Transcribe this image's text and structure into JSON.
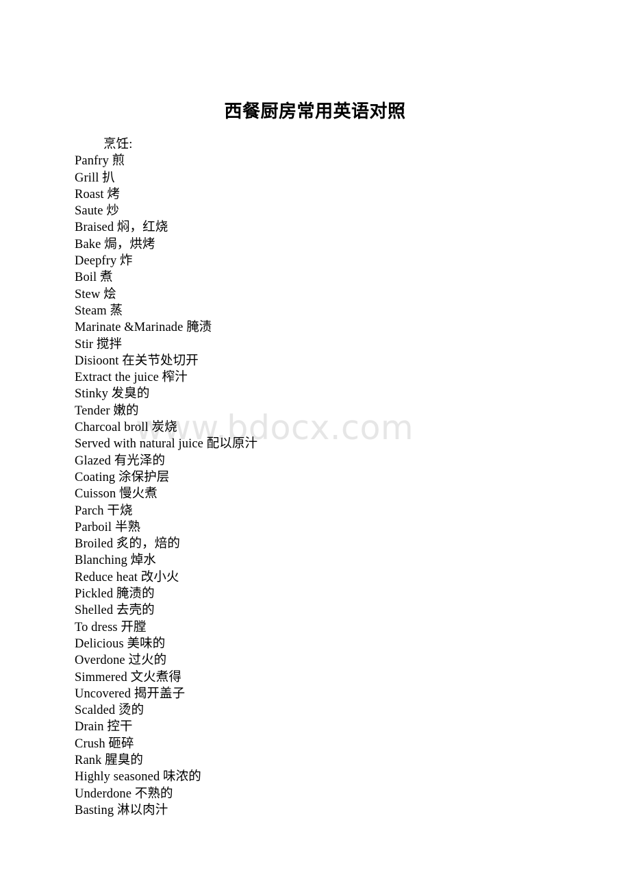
{
  "document": {
    "title": "西餐厨房常用英语对照",
    "watermark": "www.bdocx.com",
    "section_heading": "烹饪:",
    "entries": [
      "Panfry 煎",
      "Grill 扒",
      "Roast 烤",
      "Saute 炒",
      "Braised 焖，红烧",
      "Bake 焗，烘烤",
      "Deepfry 炸",
      "Boil 煮",
      "Stew 烩",
      "Steam 蒸",
      "Marinate &Marinade 腌渍",
      "Stir 搅拌",
      "Disioont 在关节处切开",
      "Extract the juice 榨汁",
      "Stinky 发臭的",
      "Tender 嫩的",
      "Charcoal broll 炭烧",
      "Served with natural juice 配以原汁",
      "Glazed 有光泽的",
      "Coating 涂保护层",
      "Cuisson 慢火煮",
      "Parch 干烧",
      "Parboil 半熟",
      "Broiled 炙的，焙的",
      "Blanching 焯水",
      "Reduce heat 改小火",
      "Pickled 腌渍的",
      "Shelled 去壳的",
      "To dress 开膛",
      "Delicious 美味的",
      "Overdone 过火的",
      "Simmered 文火煮得",
      "Uncovered 揭开盖子",
      "Scalded 烫的",
      "Drain 控干",
      "Crush 砸碎",
      "Rank 腥臭的",
      "Highly seasoned 味浓的",
      "Underdone 不熟的",
      "Basting 淋以肉汁"
    ]
  },
  "colors": {
    "text": "#000000",
    "watermark": "#e6e6e6",
    "page_background": "#ffffff"
  }
}
